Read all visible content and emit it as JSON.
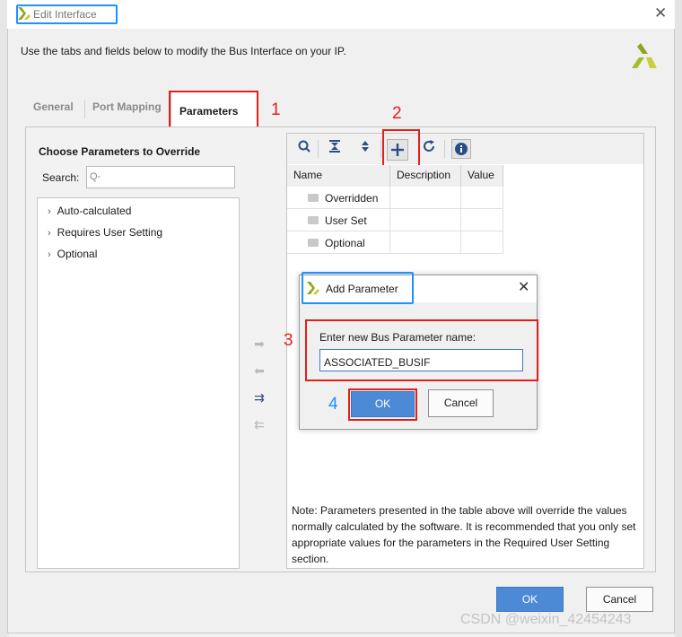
{
  "window": {
    "title": "Edit Interface",
    "close_symbol": "✕",
    "intro": "Use the tabs and fields below to modify the Bus Interface on your IP."
  },
  "tabs": [
    "General",
    "Port Mapping",
    "Parameters"
  ],
  "left_panel": {
    "title": "Choose Parameters to Override",
    "search_label": "Search:",
    "search_placeholder": "Q-",
    "tree": [
      "Auto-calculated",
      "Requires User Setting",
      "Optional"
    ]
  },
  "toolbar": {
    "icons": [
      "search-icon",
      "collapse-all-icon",
      "expand-all-icon",
      "add-icon",
      "refresh-icon",
      "info-icon"
    ]
  },
  "table": {
    "columns": [
      "Name",
      "Description",
      "Value"
    ],
    "rows": [
      "Overridden",
      "User Set",
      "Optional"
    ]
  },
  "note": "Note: Parameters presented in the table above will override the values normally calculated by the software. It is recommended that you only set appropriate values for the parameters in the Required User Setting section.",
  "dialog": {
    "title": "Add Parameter",
    "label": "Enter new Bus Parameter name:",
    "input_value": "ASSOCIATED_BUSIF",
    "ok": "OK",
    "cancel": "Cancel",
    "close_symbol": "✕"
  },
  "footer": {
    "ok": "OK",
    "cancel": "Cancel"
  },
  "annotations": [
    "1",
    "2",
    "3",
    "4"
  ],
  "watermark": "CSDN @weixin_42454243",
  "colors": {
    "accent": "#4d8ad6",
    "annotation_red": "#e0201b",
    "annotation_blue": "#1e90ff",
    "logo": "#8fa51e"
  }
}
